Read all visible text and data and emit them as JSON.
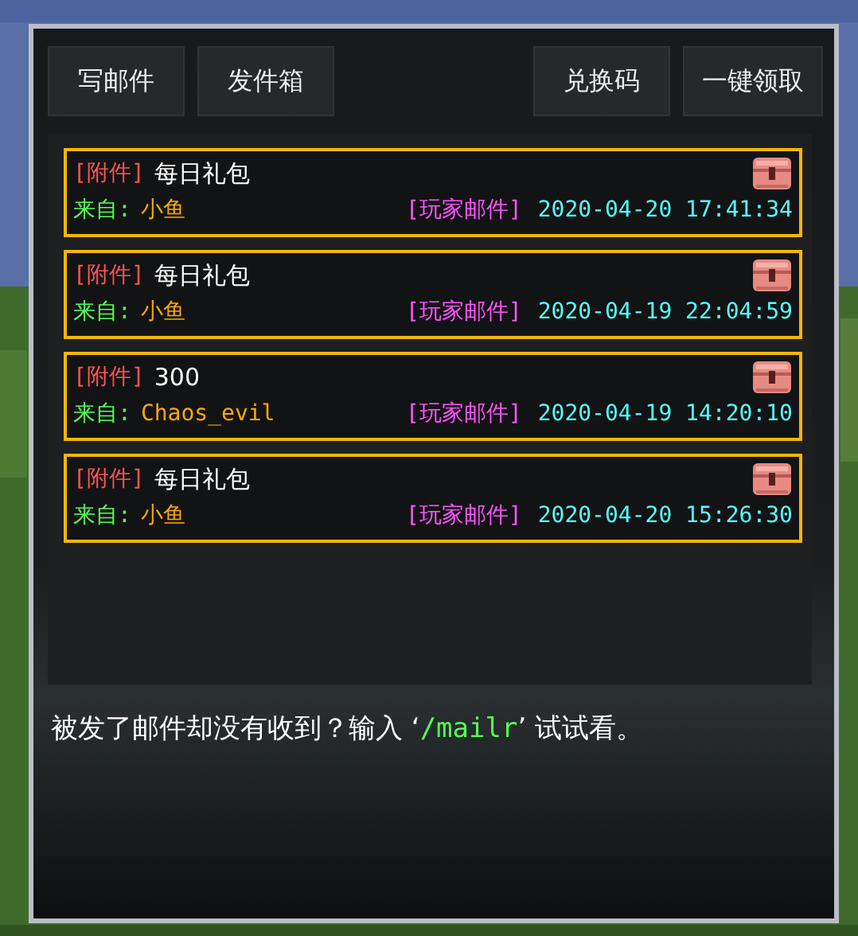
{
  "toolbar": {
    "left_buttons": [
      "写邮件",
      "发件箱"
    ],
    "right_buttons": [
      "兑换码",
      "一键领取"
    ]
  },
  "mails": [
    {
      "tag": "[附件]",
      "title": "每日礼包",
      "from_label": "来自:",
      "sender": "小鱼",
      "type": "[玩家邮件]",
      "date": "2020-04-20 17:41:34"
    },
    {
      "tag": "[附件]",
      "title": "每日礼包",
      "from_label": "来自:",
      "sender": "小鱼",
      "type": "[玩家邮件]",
      "date": "2020-04-19 22:04:59"
    },
    {
      "tag": "[附件]",
      "title": "300",
      "from_label": "来自:",
      "sender": "Chaos_evil",
      "type": "[玩家邮件]",
      "date": "2020-04-19 14:20:10"
    },
    {
      "tag": "[附件]",
      "title": "每日礼包",
      "from_label": "来自:",
      "sender": "小鱼",
      "type": "[玩家邮件]",
      "date": "2020-04-20 15:26:30"
    }
  ],
  "hint": {
    "before": "被发了邮件却没有收到？输入 ‘",
    "command": "/mailr",
    "after": "’ 试试看。"
  }
}
